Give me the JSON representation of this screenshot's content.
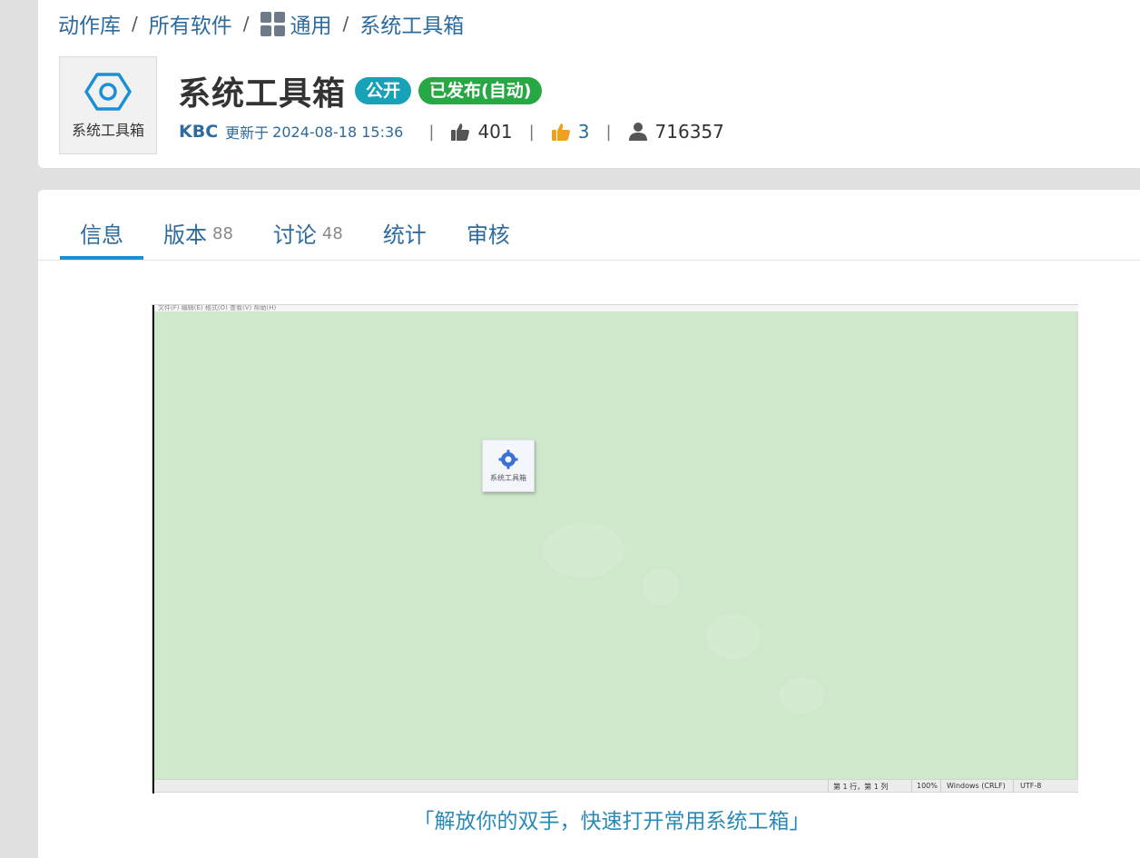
{
  "breadcrumb": {
    "items": [
      "动作库",
      "所有软件",
      "通用",
      "系统工具箱"
    ],
    "separator": "/"
  },
  "app": {
    "logo_label": "系统工具箱",
    "title": "系统工具箱",
    "badge_public": "公开",
    "badge_published": "已发布(自动)",
    "author": "KBC",
    "updated_prefix": "更新于",
    "updated_time": "2024-08-18 15:36",
    "likes": "401",
    "dislikes": "3",
    "users": "716357",
    "divider": "|"
  },
  "tabs": [
    {
      "label": "信息",
      "count": ""
    },
    {
      "label": "版本",
      "count": "88"
    },
    {
      "label": "讨论",
      "count": "48"
    },
    {
      "label": "统计",
      "count": ""
    },
    {
      "label": "审核",
      "count": ""
    }
  ],
  "preview": {
    "menubar": "文件(F)   编辑(E)   格式(O)   查看(V)   帮助(H)",
    "mini_label": "系统工具箱",
    "status": {
      "position": "第 1 行，第 1 列",
      "zoom": "100%",
      "line_ending": "Windows (CRLF)",
      "encoding": "UTF-8"
    }
  },
  "caption": "「解放你的双手，快速打开常用系统工箱」",
  "colors": {
    "link": "#2d6b9e",
    "badge_public": "#17a2b8",
    "badge_published": "#28a745",
    "tab_active": "#1a8fd6",
    "preview_bg": "#cfe7cb"
  }
}
